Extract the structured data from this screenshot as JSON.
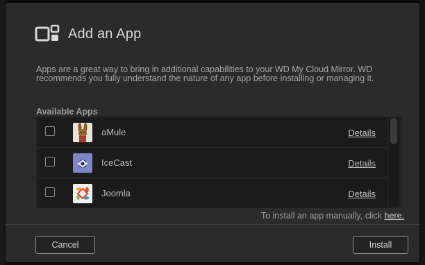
{
  "dialog": {
    "title": "Add an App",
    "title_icon": "apps-icon",
    "description": "Apps are a great way to bring in additional capabilities to your WD My Cloud Mirror. WD recommends you fully understand the nature of any app before installing or managing it.",
    "section_label": "Available Apps",
    "apps": [
      {
        "name": "aMule",
        "details_label": "Details",
        "icon": "amule-icon",
        "checked": false
      },
      {
        "name": "IceCast",
        "details_label": "Details",
        "icon": "icecast-icon",
        "checked": false
      },
      {
        "name": "Joomla",
        "details_label": "Details",
        "icon": "joomla-icon",
        "checked": false
      }
    ],
    "manual_install_text": "To install an app manually, click",
    "manual_install_link": "here.",
    "cancel_label": "Cancel",
    "install_label": "Install"
  },
  "colors": {
    "dialog_bg": "#2b2b2c",
    "list_bg": "#202021",
    "row_bg": "#1b1b1c",
    "text": "#b9b9b9"
  }
}
